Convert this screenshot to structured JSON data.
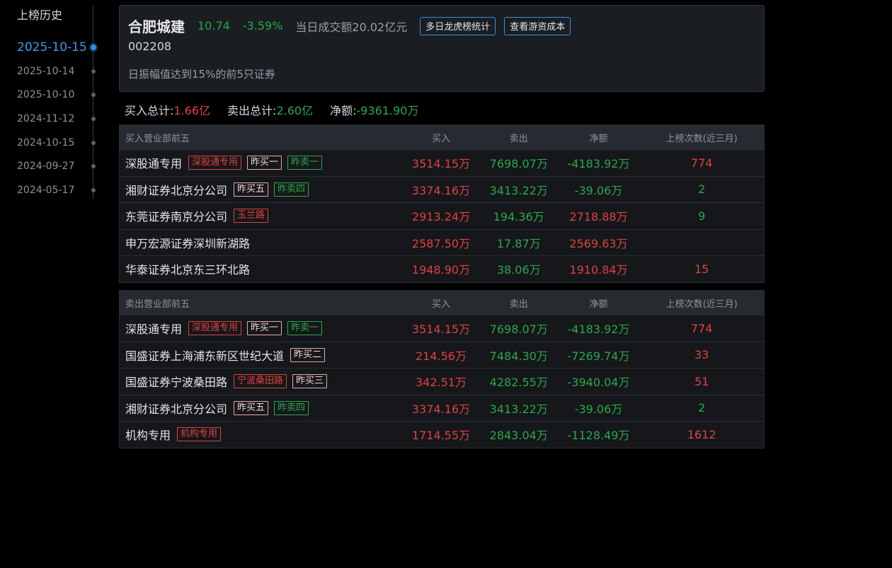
{
  "history": {
    "title": "上榜历史",
    "dates": [
      "2025-10-15",
      "2025-10-14",
      "2025-10-10",
      "2024-11-12",
      "2024-10-15",
      "2024-09-27",
      "2024-05-17"
    ],
    "active_index": 0
  },
  "stock": {
    "name": "合肥城建",
    "price": "10.74",
    "change": "-3.59%",
    "volume": "当日成交额20.02亿元",
    "code": "002208",
    "reason": "日振幅值达到15%的前5只证券",
    "btn_multi_day": "多日龙虎榜统计",
    "btn_cost": "查看游资成本"
  },
  "totals": {
    "buy_label": "买入总计:",
    "buy_value": "1.66亿",
    "sell_label": "卖出总计:",
    "sell_value": "2.60亿",
    "net_label": "净额:",
    "net_value": "-9361.90万"
  },
  "buy_table": {
    "headers": [
      "买入营业部前五",
      "买入",
      "卖出",
      "净额",
      "上榜次数(近三月)"
    ],
    "rows": [
      {
        "name": "深股通专用",
        "tags": [
          {
            "text": "深股通专用",
            "style": "red"
          },
          {
            "text": "昨买一",
            "style": "pink"
          },
          {
            "text": "昨卖一",
            "style": "green"
          }
        ],
        "buy": "3514.15万",
        "sell": "7698.07万",
        "net": "-4183.92万",
        "net_style": "green",
        "count": "774",
        "count_style": "red"
      },
      {
        "name": "湘财证券北京分公司",
        "tags": [
          {
            "text": "昨买五",
            "style": "pink"
          },
          {
            "text": "昨卖四",
            "style": "green"
          }
        ],
        "buy": "3374.16万",
        "sell": "3413.22万",
        "net": "-39.06万",
        "net_style": "green",
        "count": "2",
        "count_style": "green"
      },
      {
        "name": "东莞证券南京分公司",
        "tags": [
          {
            "text": "玉兰路",
            "style": "red"
          }
        ],
        "buy": "2913.24万",
        "sell": "194.36万",
        "net": "2718.88万",
        "net_style": "red",
        "count": "9",
        "count_style": "green"
      },
      {
        "name": "申万宏源证券深圳新湖路",
        "tags": [],
        "buy": "2587.50万",
        "sell": "17.87万",
        "net": "2569.63万",
        "net_style": "red",
        "count": "",
        "count_style": "red"
      },
      {
        "name": "华泰证券北京东三环北路",
        "tags": [],
        "buy": "1948.90万",
        "sell": "38.06万",
        "net": "1910.84万",
        "net_style": "red",
        "count": "15",
        "count_style": "red"
      }
    ]
  },
  "sell_table": {
    "headers": [
      "卖出营业部前五",
      "买入",
      "卖出",
      "净额",
      "上榜次数(近三月)"
    ],
    "rows": [
      {
        "name": "深股通专用",
        "tags": [
          {
            "text": "深股通专用",
            "style": "red"
          },
          {
            "text": "昨买一",
            "style": "pink"
          },
          {
            "text": "昨卖一",
            "style": "green"
          }
        ],
        "buy": "3514.15万",
        "sell": "7698.07万",
        "net": "-4183.92万",
        "net_style": "green",
        "count": "774",
        "count_style": "red"
      },
      {
        "name": "国盛证券上海浦东新区世纪大道",
        "tags": [
          {
            "text": "昨买二",
            "style": "pink"
          }
        ],
        "buy": "214.56万",
        "sell": "7484.30万",
        "net": "-7269.74万",
        "net_style": "green",
        "count": "33",
        "count_style": "red"
      },
      {
        "name": "国盛证券宁波桑田路",
        "tags": [
          {
            "text": "宁波桑田路",
            "style": "red"
          },
          {
            "text": "昨买三",
            "style": "pink"
          }
        ],
        "buy": "342.51万",
        "sell": "4282.55万",
        "net": "-3940.04万",
        "net_style": "green",
        "count": "51",
        "count_style": "red"
      },
      {
        "name": "湘财证券北京分公司",
        "tags": [
          {
            "text": "昨买五",
            "style": "pink"
          },
          {
            "text": "昨卖四",
            "style": "green"
          }
        ],
        "buy": "3374.16万",
        "sell": "3413.22万",
        "net": "-39.06万",
        "net_style": "green",
        "count": "2",
        "count_style": "green"
      },
      {
        "name": "机构专用",
        "tags": [
          {
            "text": "机构专用",
            "style": "red"
          }
        ],
        "buy": "1714.55万",
        "sell": "2843.04万",
        "net": "-1128.49万",
        "net_style": "green",
        "count": "1612",
        "count_style": "red"
      }
    ]
  }
}
